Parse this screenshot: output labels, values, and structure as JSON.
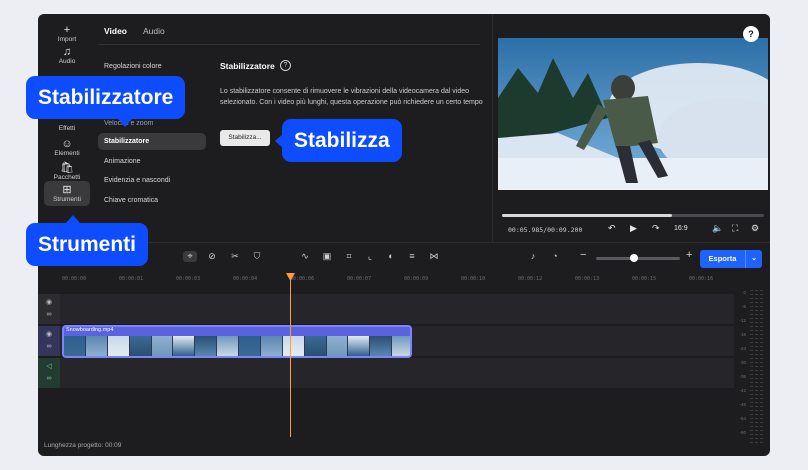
{
  "rail": [
    {
      "icon": "plus-icon",
      "glyph": "+",
      "label": "Import"
    },
    {
      "icon": "music-note-icon",
      "glyph": "♫",
      "label": "Audio"
    },
    {
      "icon": "sparkle-icon",
      "glyph": "",
      "label": "Effetti"
    },
    {
      "icon": "smiley-icon",
      "glyph": "☺",
      "label": "Elementi"
    },
    {
      "icon": "bag-icon",
      "glyph": "🛍",
      "label": "Pacchetti"
    },
    {
      "icon": "tools-grid-icon",
      "glyph": "⊞",
      "label": "Strumenti"
    }
  ],
  "tabs": [
    "Video",
    "Audio"
  ],
  "submenu": [
    "Regolazioni colore",
    "Velocità e zoom",
    "Stabilizzatore",
    "Animazione",
    "Evidenzia e nascondi",
    "Chiave cromatica"
  ],
  "section": {
    "title": "Stabilizzatore",
    "description": "Lo stabilizzatore consente di rimuovere le vibrazioni della videocamera dal video selezionato. Con i video più lunghi, questa operazione può richiedere un certo tempo",
    "button": "Stabilizza..."
  },
  "player": {
    "timecode": "00:05.985/00:09.200",
    "progress": 0.65,
    "ratio": "16:9",
    "help_icon": "question-icon"
  },
  "toolbar": {
    "zoom_level": 0.45,
    "export_label": "Esporta",
    "export_caret": "⌄"
  },
  "ruler": [
    "00:00:00",
    "00:00:01",
    "00:00:03",
    "00:00:04",
    "00:00:06",
    "00:00:07",
    "00:00:09",
    "00:00:10",
    "00:00:12",
    "00:00:13",
    "00:00:15",
    "00:00:16"
  ],
  "clip": {
    "name": "Snowboarding.mp4"
  },
  "meter_labels": [
    "0",
    "-6",
    "-12",
    "-18",
    "-24",
    "-30",
    "-36",
    "-42",
    "-48",
    "-54",
    "-60"
  ],
  "project_length": "Lunghezza progetto: 00:09",
  "callouts": {
    "stabilizzatore": "Stabilizzatore",
    "stabilizza": "Stabilizza",
    "strumenti": "Strumenti"
  },
  "colors": {
    "accent": "#1f63ff",
    "callout": "#0d4dff",
    "playhead": "#ff9a3d",
    "clip": "#5b62e0"
  }
}
